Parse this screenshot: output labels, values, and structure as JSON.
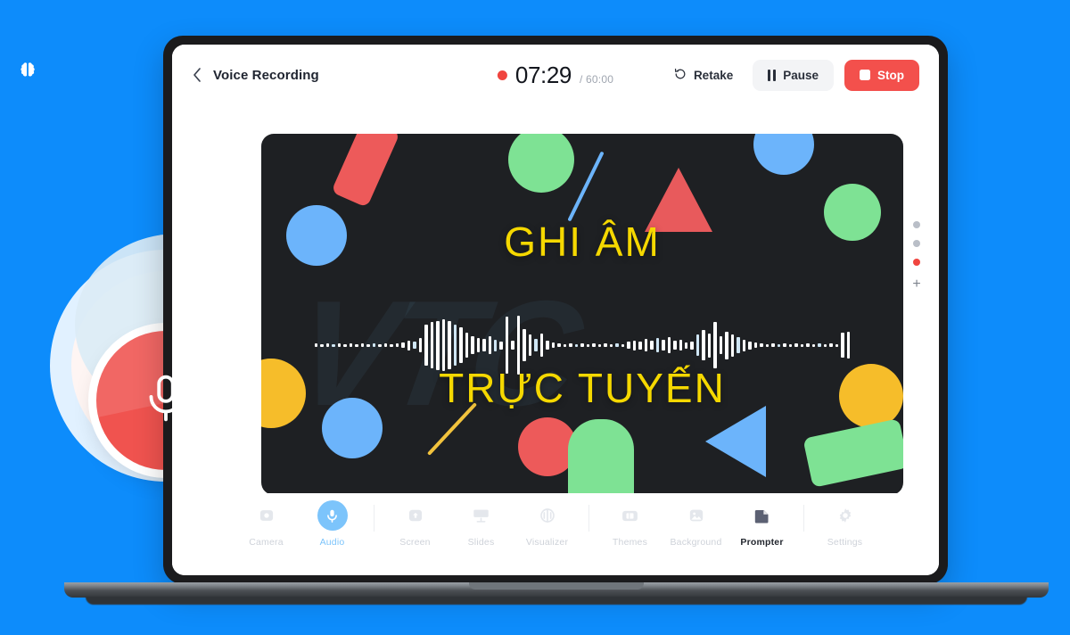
{
  "background": {
    "color": "#0d8cfb",
    "watermark_text": "VTC",
    "brain_icon": "brain-icon"
  },
  "mic_badge": {
    "icon": "microphone-icon",
    "color": "#f0534f"
  },
  "app": {
    "topbar": {
      "back_icon": "chevron-left-icon",
      "title": "Voice Recording",
      "record_dot": "record-dot-icon",
      "elapsed": "07:29",
      "total": "/ 60:00",
      "retake_icon": "rotate-ccw-icon",
      "retake_label": "Retake",
      "pause_icon": "pause-icon",
      "pause_label": "Pause",
      "stop_icon": "stop-square-icon",
      "stop_label": "Stop",
      "stop_color": "#f3504c"
    },
    "canvas": {
      "background": "#1e2023",
      "watermark_text": "VTC",
      "headline": "GHI ÂM",
      "subline": "TRỰC TUYẾN",
      "text_color": "#f5d800",
      "waveform": {
        "bar_color": "#ffffff",
        "heights": [
          4,
          3,
          4,
          3,
          4,
          3,
          4,
          3,
          4,
          3,
          4,
          3,
          4,
          3,
          4,
          6,
          11,
          8,
          16,
          46,
          52,
          55,
          58,
          54,
          46,
          40,
          28,
          20,
          16,
          14,
          20,
          13,
          9,
          64,
          10,
          66,
          36,
          24,
          14,
          26,
          10,
          6,
          4,
          3,
          4,
          3,
          4,
          3,
          4,
          3,
          4,
          3,
          4,
          3,
          8,
          11,
          9,
          14,
          10,
          16,
          12,
          18,
          10,
          12,
          7,
          9,
          24,
          34,
          27,
          52,
          20,
          31,
          25,
          18,
          13,
          9,
          6,
          4,
          3,
          4,
          3,
          4,
          3,
          4,
          3,
          4,
          3,
          4,
          3,
          4,
          3,
          28,
          30
        ]
      },
      "shapes": [
        {
          "name": "shape-red-rounded-rect",
          "color": "#ed5a5a"
        },
        {
          "name": "shape-green-circle",
          "color": "#7ee294"
        },
        {
          "name": "shape-blue-circle",
          "color": "#6cb4fb"
        },
        {
          "name": "shape-red-triangle",
          "color": "#e85a5c"
        },
        {
          "name": "shape-blue-line",
          "color": "#6cb4fb"
        },
        {
          "name": "shape-yellow-circle",
          "color": "#f6bd2a"
        },
        {
          "name": "shape-yellow-line",
          "color": "#f2c33d"
        },
        {
          "name": "shape-blue-triangle",
          "color": "#6cb4fb"
        },
        {
          "name": "shape-green-rounded-rect",
          "color": "#7ee294"
        }
      ]
    },
    "side_rail": {
      "dots": [
        "grey",
        "grey",
        "red"
      ],
      "add_label": "+"
    },
    "toolbar": {
      "groups": [
        [
          {
            "label": "Camera",
            "icon": "camera-icon",
            "state": "inactive"
          },
          {
            "label": "Audio",
            "icon": "microphone-icon",
            "state": "active-blue"
          }
        ],
        [
          {
            "label": "Screen",
            "icon": "screen-share-icon",
            "state": "inactive"
          },
          {
            "label": "Slides",
            "icon": "slides-icon",
            "state": "inactive"
          },
          {
            "label": "Visualizer",
            "icon": "visualizer-icon",
            "state": "inactive"
          }
        ],
        [
          {
            "label": "Themes",
            "icon": "themes-icon",
            "state": "inactive"
          },
          {
            "label": "Background",
            "icon": "image-icon",
            "state": "inactive"
          },
          {
            "label": "Prompter",
            "icon": "prompter-icon",
            "state": "active-dark"
          }
        ],
        [
          {
            "label": "Settings",
            "icon": "gear-icon",
            "state": "inactive"
          }
        ]
      ]
    }
  }
}
